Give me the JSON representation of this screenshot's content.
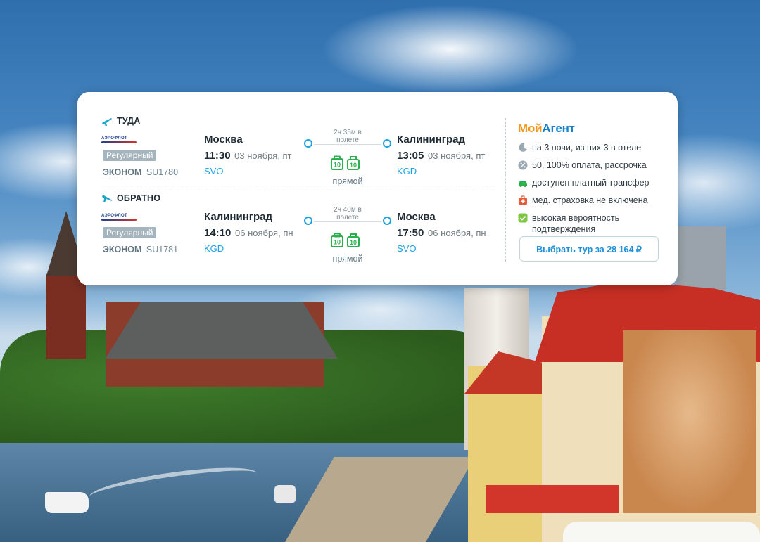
{
  "outbound": {
    "direction_label": "ТУДА",
    "airline_logo": "АЭРОФЛОТ",
    "tariff": "Регулярный",
    "class_name": "ЭКОНОМ",
    "flight_number": "SU1780",
    "from_city": "Москва",
    "dep_time": "11:30",
    "dep_date": "03 ноября, пт",
    "from_airport": "SVO",
    "duration": "2ч 35м в полете",
    "bag_icons": [
      "baggage-10kg-icon",
      "hand-luggage-10kg-icon"
    ],
    "bag_weight_label": "10",
    "direct_label": "прямой",
    "to_city": "Калининград",
    "arr_time": "13:05",
    "arr_date": "03 ноября, пт",
    "to_airport": "KGD"
  },
  "inbound": {
    "direction_label": "ОБРАТНО",
    "airline_logo": "АЭРОФЛОТ",
    "tariff": "Регулярный",
    "class_name": "ЭКОНОМ",
    "flight_number": "SU1781",
    "from_city": "Калининград",
    "dep_time": "14:10",
    "dep_date": "06 ноября, пн",
    "from_airport": "KGD",
    "duration": "2ч 40м в полете",
    "bag_icons": [
      "baggage-10kg-icon",
      "hand-luggage-10kg-icon"
    ],
    "bag_weight_label": "10",
    "direct_label": "прямой",
    "to_city": "Москва",
    "arr_time": "17:50",
    "arr_date": "06 ноября, пн",
    "to_airport": "SVO"
  },
  "agent": {
    "logo_part1": "Мой",
    "logo_part2": "Агент",
    "features": [
      {
        "icon": "moon-icon",
        "text": "на 3 ночи, из них 3 в отеле"
      },
      {
        "icon": "percent-icon",
        "text": "50, 100% оплата, рассрочка"
      },
      {
        "icon": "car-icon",
        "text": "доступен платный трансфер"
      },
      {
        "icon": "medkit-icon",
        "text": "мед. страховка не включена"
      },
      {
        "icon": "check-icon",
        "text": "высокая вероятность подтверждения"
      }
    ],
    "cta_label": "Выбрать тур за 28 164 ₽"
  },
  "colors": {
    "accent_blue": "#1aa3e0",
    "plane_teal": "#1fa3c9",
    "bag_green": "#2bb24c",
    "agent_orange": "#f39a1e",
    "agent_blue": "#1a7fc8",
    "badge_gray": "#a5b4bd"
  },
  "background_scene": "kaliningrad-fishing-village-photo"
}
